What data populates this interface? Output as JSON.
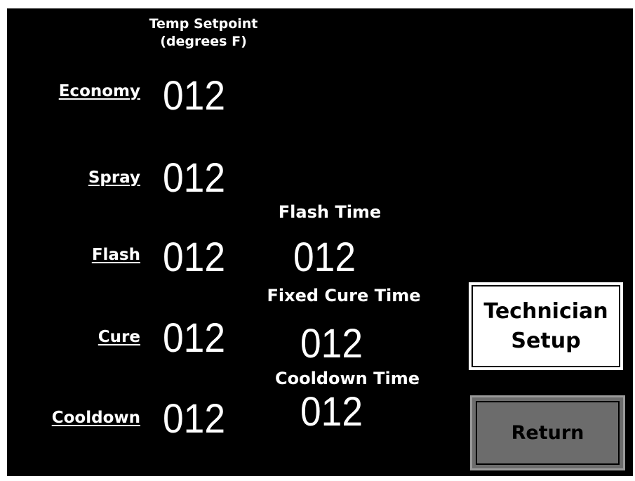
{
  "headers": {
    "temp_setpoint_line1": "Temp Setpoint",
    "temp_setpoint_line2": "(degrees F)",
    "flash_time": "Flash Time",
    "fixed_cure_time": "Fixed Cure Time",
    "cooldown_time": "Cooldown Time"
  },
  "rows": [
    {
      "label": "Economy",
      "temp": "012"
    },
    {
      "label": "Spray",
      "temp": "012"
    },
    {
      "label": "Flash",
      "temp": "012",
      "time": "012"
    },
    {
      "label": "Cure",
      "temp": "012",
      "time": "012"
    },
    {
      "label": "Cooldown",
      "temp": "012",
      "time": "012"
    }
  ],
  "buttons": {
    "technician_line1": "Technician",
    "technician_line2": "Setup",
    "return": "Return"
  },
  "colors": {
    "background": "#000000",
    "text": "#ffffff",
    "technician_button": "#ffffff",
    "return_button": "#6c6c6c"
  }
}
